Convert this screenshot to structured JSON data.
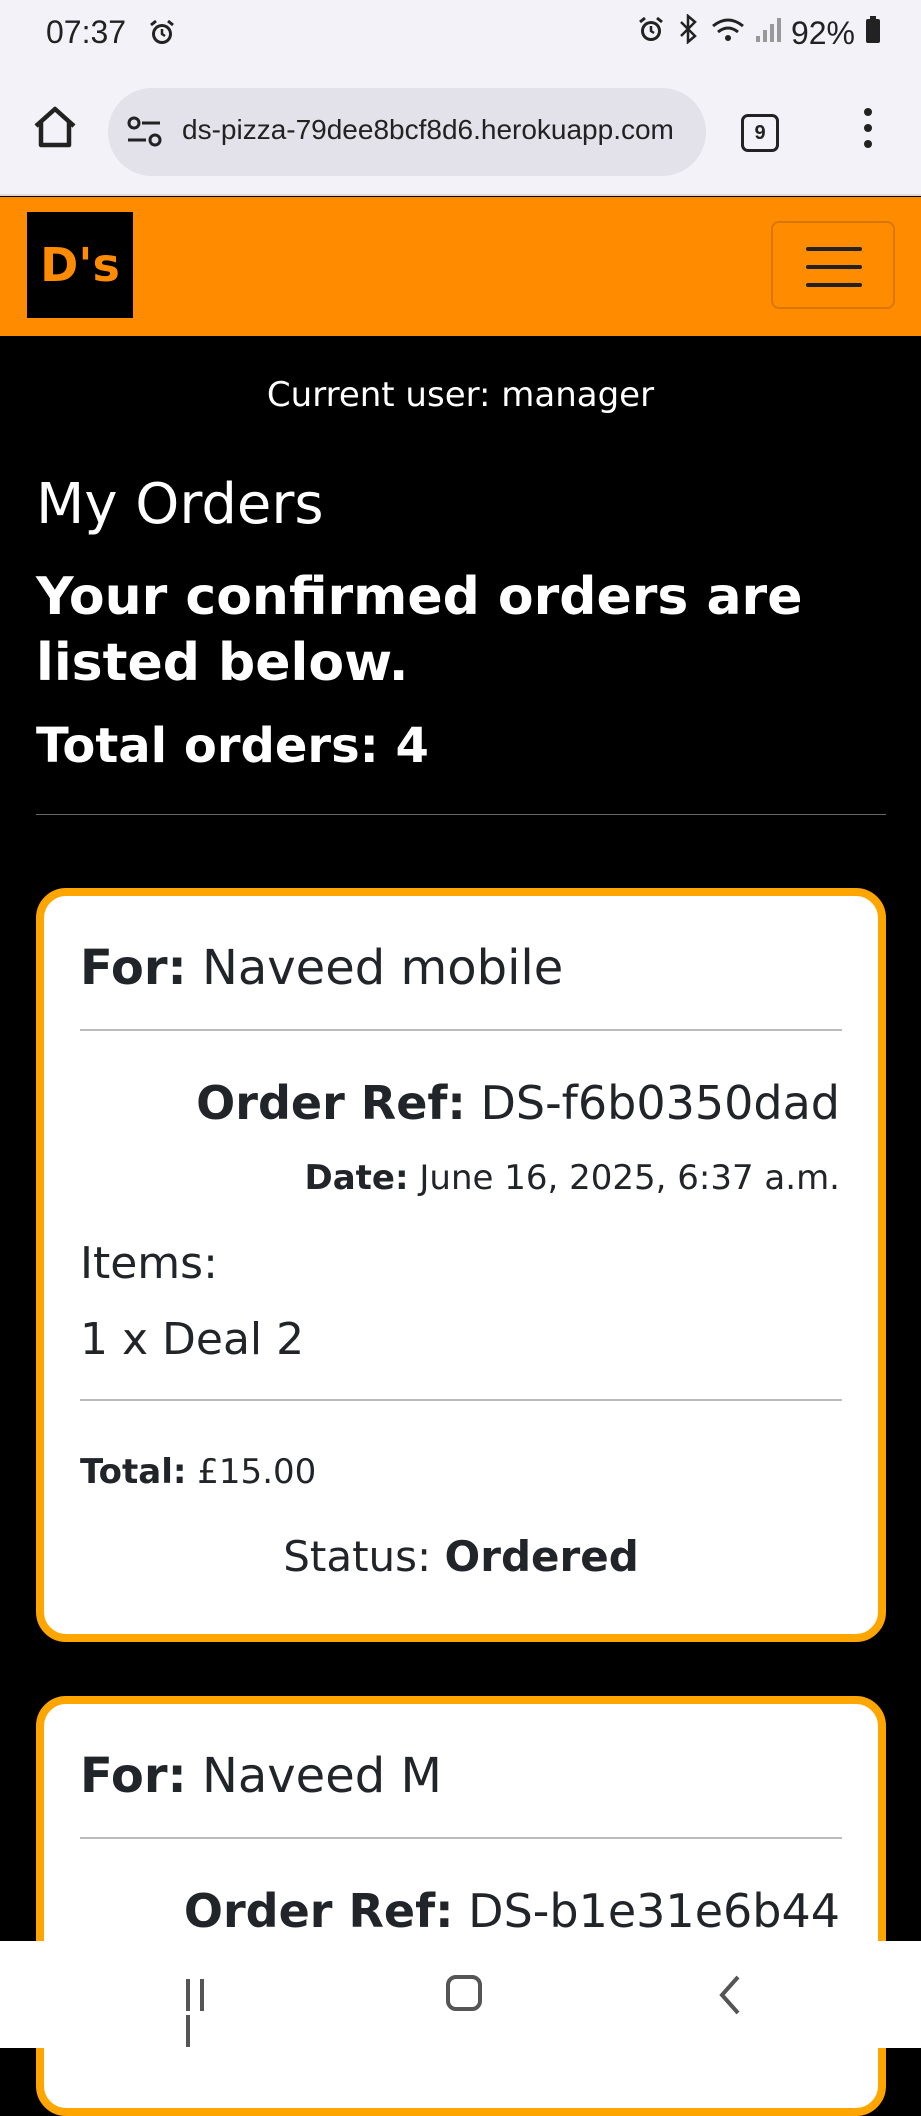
{
  "status_bar": {
    "time": "07:37",
    "battery": "92%"
  },
  "browser": {
    "url": "ds-pizza-79dee8bcf8d6.herokuapp.com",
    "tab_count": "9"
  },
  "navbar": {
    "logo_text": "D's",
    "brand_color": "#ff8c00"
  },
  "page": {
    "current_user": "Current user: manager",
    "title": "My Orders",
    "subtitle": "Your confirmed orders are listed below.",
    "total_orders": "Total orders: 4"
  },
  "orders": [
    {
      "for_label": "For:",
      "for_value": "Naveed mobile",
      "ref_label": "Order Ref:",
      "ref_value": "DS-f6b0350dad",
      "date_label": "Date:",
      "date_value": "June 16, 2025, 6:37 a.m.",
      "items_label": "Items:",
      "items": [
        "1 x Deal 2"
      ],
      "total_label": "Total:",
      "total_value": "£15.00",
      "status_label": "Status:",
      "status_value": "Ordered"
    },
    {
      "for_label": "For:",
      "for_value": "Naveed M",
      "ref_label": "Order Ref:",
      "ref_value": "DS-b1e31e6b44"
    }
  ]
}
